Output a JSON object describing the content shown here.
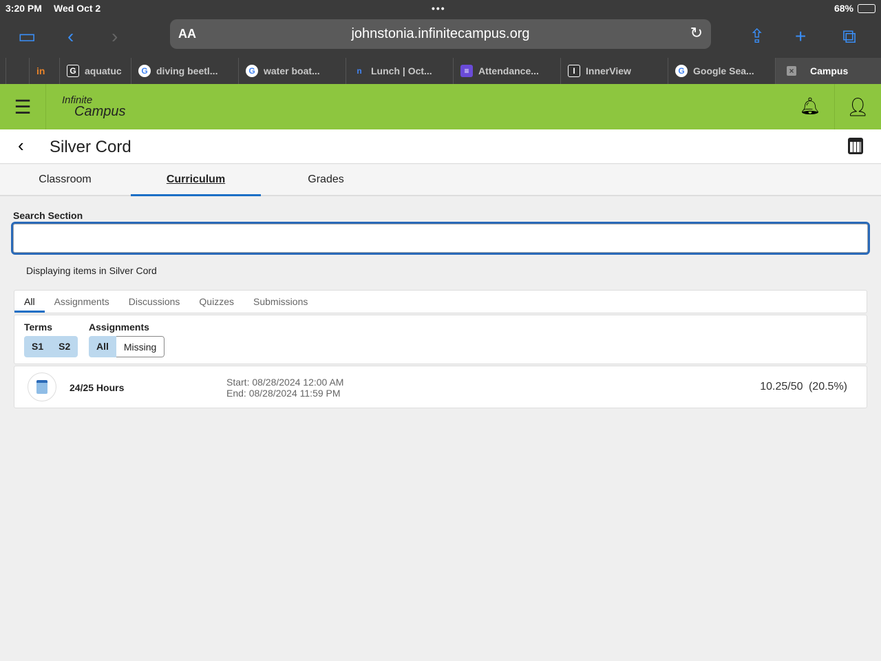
{
  "status": {
    "time": "3:20 PM",
    "date": "Wed Oct 2",
    "battery": "68%"
  },
  "browser": {
    "text_size": "AA",
    "url": "johnstonia.infinitecampus.org",
    "tabs": [
      {
        "label": "aquatuc",
        "icon": "G"
      },
      {
        "label": "diving beetl...",
        "icon": "G"
      },
      {
        "label": "water boat...",
        "icon": "G"
      },
      {
        "label": "Lunch | Oct...",
        "icon": "n"
      },
      {
        "label": "Attendance...",
        "icon": "list"
      },
      {
        "label": "InnerView",
        "icon": "I"
      },
      {
        "label": "Google Sea...",
        "icon": "G"
      },
      {
        "label": "Campus",
        "icon": "x"
      }
    ]
  },
  "app": {
    "logo_line1": "Infinite",
    "logo_line2": "Campus",
    "brand_color": "#8dc63f"
  },
  "page": {
    "title": "Silver Cord",
    "tabs": [
      "Classroom",
      "Curriculum",
      "Grades"
    ],
    "active_tab": "Curriculum"
  },
  "search": {
    "label": "Search Section",
    "value": ""
  },
  "display_text": "Displaying items in Silver Cord",
  "subtabs": [
    "All",
    "Assignments",
    "Discussions",
    "Quizzes",
    "Submissions"
  ],
  "filters": {
    "terms_label": "Terms",
    "terms": [
      "S1",
      "S2"
    ],
    "assignments_label": "Assignments",
    "assignments": [
      "All",
      "Missing"
    ]
  },
  "items": [
    {
      "name": "24/25 Hours",
      "start": "Start: 08/28/2024 12:00 AM",
      "end": "End: 08/28/2024 11:59 PM",
      "score": "10.25/50",
      "percent": "(20.5%)"
    }
  ]
}
